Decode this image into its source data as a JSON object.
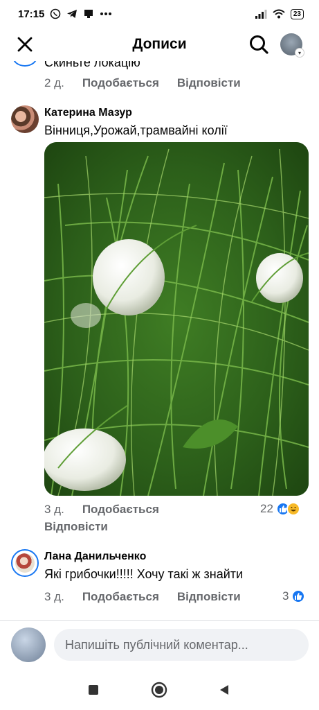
{
  "status_bar": {
    "time": "17:15",
    "battery": "23"
  },
  "header": {
    "title": "Дописи"
  },
  "partial_comment": {
    "text": "Скиньте локацію",
    "time": "2 д.",
    "like_label": "Подобається",
    "reply_label": "Відповісти"
  },
  "comments": [
    {
      "author": "Катерина Мазур",
      "text": "Вінниця,Урожай,трамвайні колії",
      "time": "3 д.",
      "like_label": "Подобається",
      "reply_label": "Відповісти",
      "reaction_count": "22"
    },
    {
      "author": "Лана Данильченко",
      "text": "Які грибочки!!!!! Хочу такі ж знайти",
      "time": "3 д.",
      "like_label": "Подобається",
      "reply_label": "Відповісти",
      "reaction_count": "3"
    }
  ],
  "composer": {
    "placeholder": "Напишіть публічний коментар..."
  },
  "icons": {
    "close": "close-icon",
    "search": "search-icon",
    "like": "like-icon",
    "haha": "haha-icon",
    "nav_recent": "square-icon",
    "nav_home": "circle-icon",
    "nav_back": "triangle-back-icon"
  },
  "colors": {
    "accent": "#1877f2",
    "muted": "#65676b",
    "text": "#050505"
  }
}
